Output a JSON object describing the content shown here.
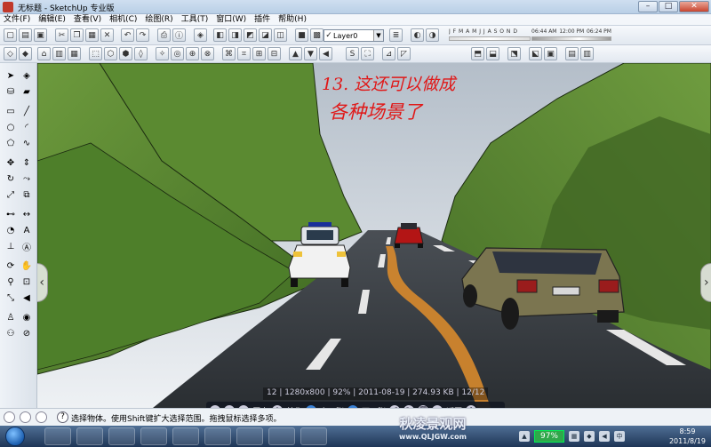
{
  "window": {
    "title": "无标题 - SketchUp 专业版",
    "controls": {
      "minimize": "–",
      "maximize": "□",
      "close": "✕"
    }
  },
  "menu": [
    "文件(F)",
    "编辑(E)",
    "查看(V)",
    "相机(C)",
    "绘图(R)",
    "工具(T)",
    "窗口(W)",
    "插件",
    "帮助(H)"
  ],
  "toolbar": {
    "layer_select": {
      "check": "✓",
      "value": "Layer0"
    },
    "shadow_months": "J F M A M J J A S O N D",
    "shadow_time_start": "06:44 AM",
    "shadow_time_mid": "12:00 PM",
    "shadow_time_end": "06:24 PM"
  },
  "annotation": {
    "line1": "13. 这还可以做成",
    "line2": "各种场景了"
  },
  "viewer": {
    "info": "12 | 1280x800 | 92% | 2011-08-19 | 274.93 KB | 12/12",
    "zoom_in": "+",
    "zoom_out": "−",
    "original_size": "原大",
    "beautify": "美化",
    "prev": "上一张",
    "next": "下一张",
    "back": "返回"
  },
  "status": {
    "help_icon": "?",
    "hint": "选择物体。使用Shift键扩大选择范围。拖拽鼠标选择多项。"
  },
  "taskbar": {
    "battery": "97%",
    "time": "8:59",
    "date": "2011/8/19"
  },
  "watermark": {
    "line1": "秋凌景观网",
    "line2": "www.QLJGW.com"
  },
  "colors": {
    "sky_top": "#c9d3dc",
    "hill_green": "#4f7d2a",
    "road": "#2f3337",
    "road_line_yellow": "#d88a2c",
    "annotation_red": "#e01818"
  }
}
